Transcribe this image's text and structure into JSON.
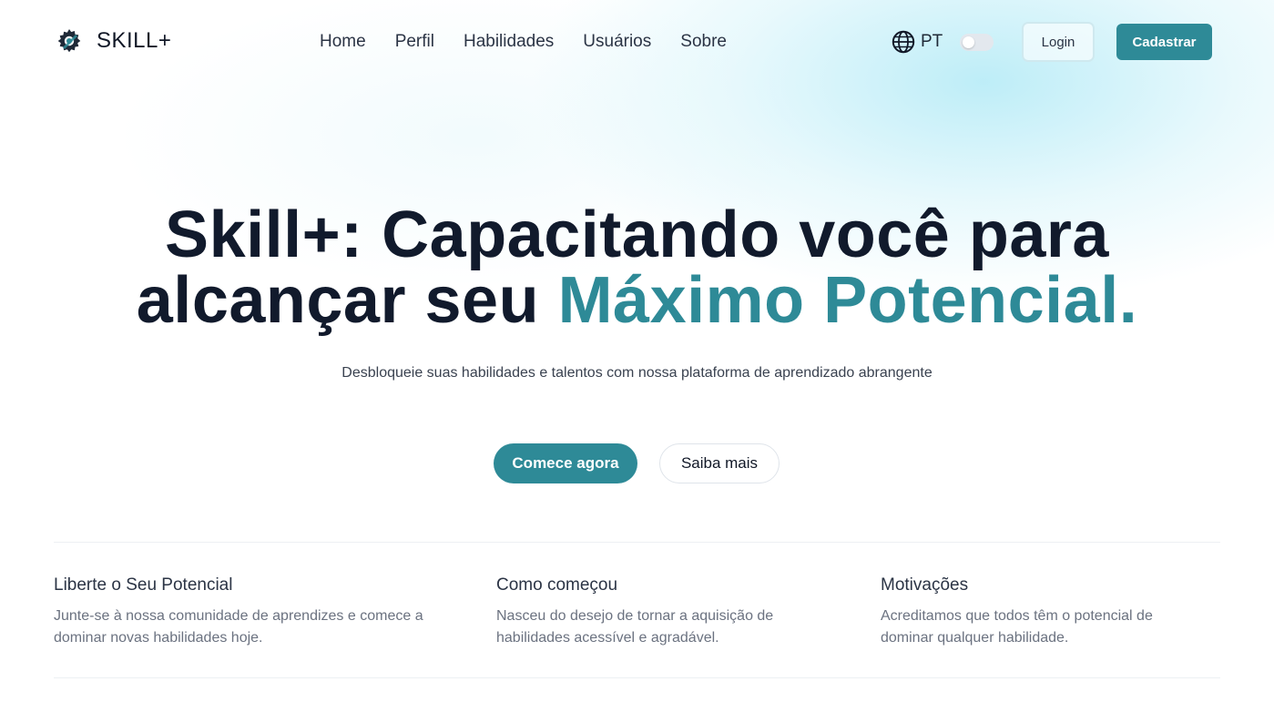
{
  "brand": {
    "name": "SKILL+",
    "logo_icon": "gear-icon"
  },
  "nav": {
    "items": [
      "Home",
      "Perfil",
      "Habilidades",
      "Usuários",
      "Sobre"
    ]
  },
  "language": {
    "icon": "globe-icon",
    "label": "PT"
  },
  "theme_toggle": {
    "state": "off"
  },
  "header_buttons": {
    "login": "Login",
    "signup": "Cadastrar"
  },
  "hero": {
    "title_line1": "Skill+: Capacitando você para",
    "title_line2_plain": "alcançar seu ",
    "title_line2_accent": "Máximo Potencial.",
    "subtitle": "Desbloqueie suas habilidades e talentos com nossa plataforma de aprendizado abrangente",
    "primary_cta": "Comece agora",
    "secondary_cta": "Saiba mais"
  },
  "features": [
    {
      "title": "Liberte o Seu Potencial",
      "text_line1": "Junte-se à nossa comunidade de aprendizes e comece a",
      "text_line2": "dominar novas habilidades hoje."
    },
    {
      "title": "Como começou",
      "text_line1": "Nasceu do desejo de tornar a aquisição de",
      "text_line2": "habilidades acessível e agradável."
    },
    {
      "title": "Motivações",
      "text_line1": "Acreditamos que todos têm o potencial de",
      "text_line2": "dominar qualquer habilidade."
    }
  ],
  "colors": {
    "accent": "#2e8a97",
    "heading": "#111a2c",
    "muted": "#6b7280"
  }
}
